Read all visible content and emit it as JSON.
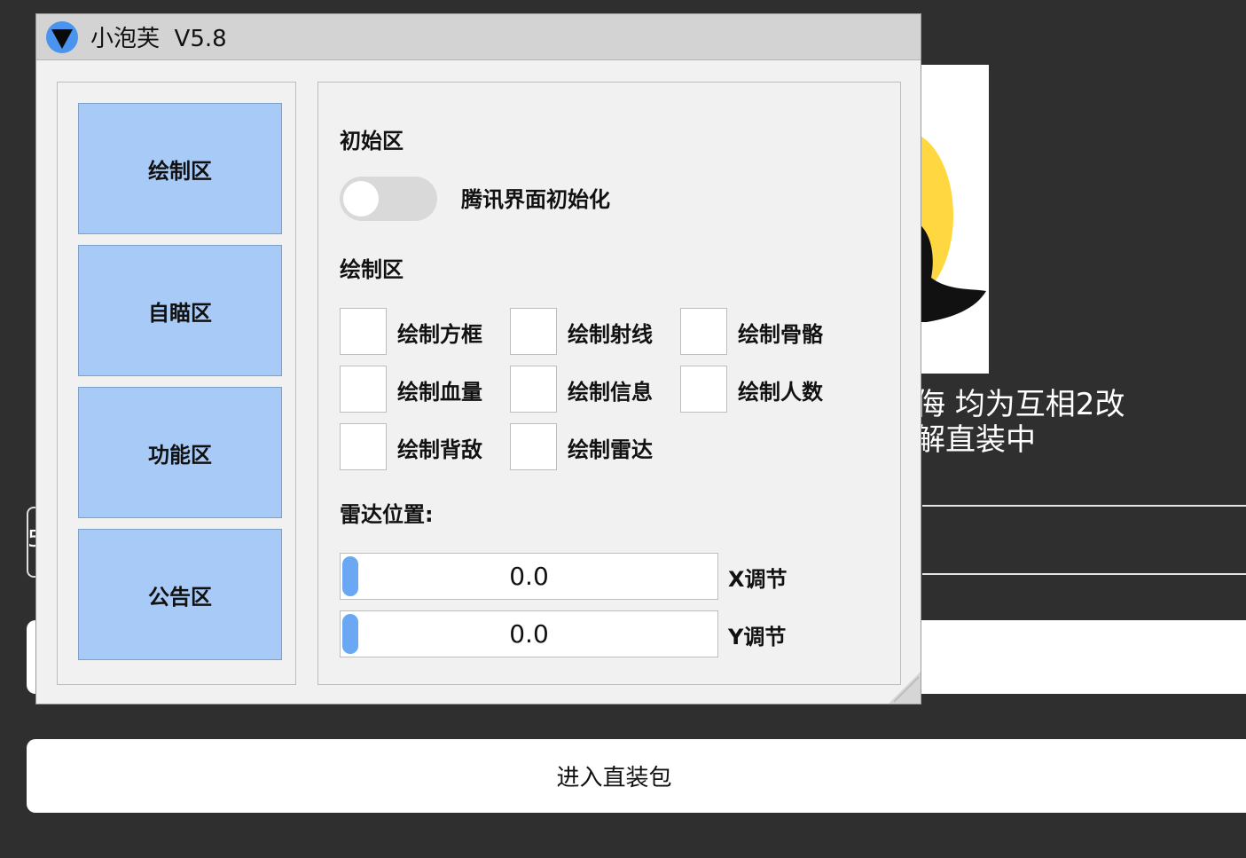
{
  "background": {
    "notice_line1": "侮 均为互相2改",
    "notice_line2": "解直装中",
    "left_digit": "5",
    "enter_button": "进入直装包"
  },
  "window": {
    "title": "小泡芙  V5.8",
    "logo_icon": "down-triangle-icon",
    "accent_color": "#4a93ee"
  },
  "nav": {
    "items": [
      {
        "label": "绘制区"
      },
      {
        "label": "自瞄区"
      },
      {
        "label": "功能区"
      },
      {
        "label": "公告区"
      }
    ],
    "button_color": "#a7cbf6"
  },
  "content": {
    "init_section": {
      "title": "初始区",
      "toggle_label": "腾讯界面初始化",
      "toggle_on": false
    },
    "draw_section": {
      "title": "绘制区",
      "options": [
        {
          "label": "绘制方框",
          "checked": false
        },
        {
          "label": "绘制射线",
          "checked": false
        },
        {
          "label": "绘制骨骼",
          "checked": false
        },
        {
          "label": "绘制血量",
          "checked": false
        },
        {
          "label": "绘制信息",
          "checked": false
        },
        {
          "label": "绘制人数",
          "checked": false
        },
        {
          "label": "绘制背敌",
          "checked": false
        },
        {
          "label": "绘制雷达",
          "checked": false
        }
      ]
    },
    "radar_section": {
      "title": "雷达位置:",
      "sliders": [
        {
          "value": "0.0",
          "label": "X调节"
        },
        {
          "value": "0.0",
          "label": "Y调节"
        }
      ]
    }
  }
}
